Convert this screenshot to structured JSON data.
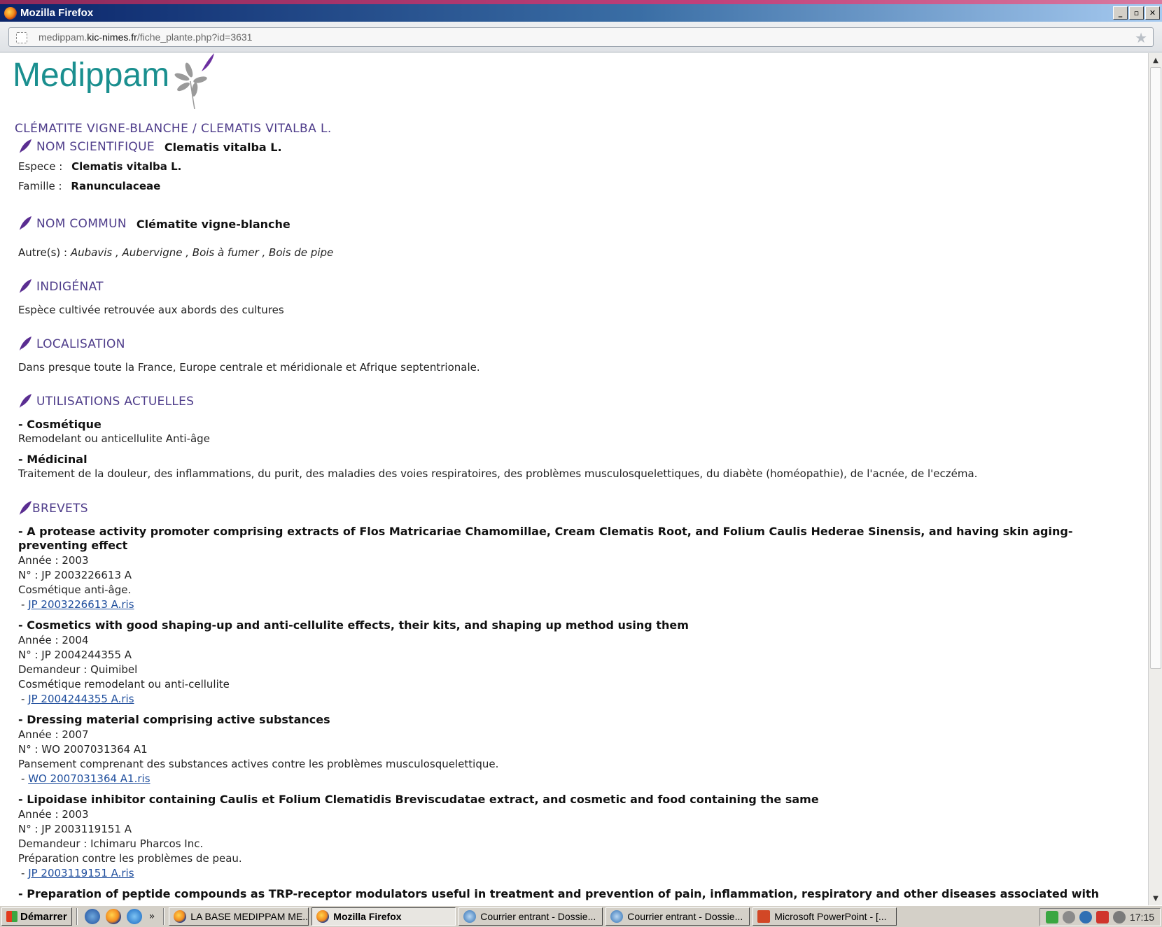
{
  "window": {
    "title": "Mozilla Firefox",
    "buttons": [
      "_",
      "▫",
      "✕"
    ]
  },
  "address": {
    "url_prefix": "medippam.",
    "url_domain": "kic-nimes.fr",
    "url_path": "/fiche_plante.php?id=3631"
  },
  "logo": {
    "text": "Medippam"
  },
  "page": {
    "title": "CLÉMATITE VIGNE-BLANCHE / CLEMATIS VITALBA L."
  },
  "sections": {
    "nom_scientifique": {
      "label": "NOM SCIENTIFIQUE",
      "value": "Clematis vitalba L.",
      "espece_label": "Espece :",
      "espece_value": "Clematis vitalba L.",
      "famille_label": "Famille  :",
      "famille_value": "Ranunculaceae"
    },
    "nom_commun": {
      "label": "NOM COMMUN",
      "value": "Clématite vigne-blanche",
      "autres_label": "Autre(s) :",
      "autres_value": "Aubavis , Aubervigne , Bois à fumer , Bois de pipe"
    },
    "indigenat": {
      "label": "INDIGÉNAT",
      "text": "Espèce cultivée retrouvée aux abords des cultures"
    },
    "localisation": {
      "label": "LOCALISATION",
      "text": "Dans presque toute la France, Europe centrale et méridionale et Afrique septentrionale."
    },
    "utilisations": {
      "label": "UTILISATIONS ACTUELLES",
      "cosmetique_title": "- Cosmétique",
      "cosmetique_text": "Remodelant ou anticellulite Anti-âge",
      "medicinal_title": "- Médicinal",
      "medicinal_text": "Traitement de la douleur, des inflammations, du purit, des maladies des voies respiratoires, des problèmes musculosquelettiques, du diabète (homéopathie), de l'acnée, de l'eczéma."
    },
    "brevets": {
      "label": "BREVETS",
      "items": [
        {
          "title": "- A protease activity promoter comprising extracts of Flos Matricariae Chamomillae, Cream Clematis Root, and Folium Caulis Hederae Sinensis, and having skin aging-preventing effect",
          "annee": "Année : 2003",
          "numero": "N° : JP 2003226613 A",
          "desc": "Cosmétique anti-âge.",
          "link_prefix": " - ",
          "link": "JP 2003226613 A.ris"
        },
        {
          "title": "- Cosmetics with good shaping-up and anti-cellulite effects, their kits, and shaping up method using them",
          "annee": "Année : 2004",
          "numero": "N° : JP 2004244355 A",
          "demandeur": "Demandeur : Quimibel",
          "desc": "Cosmétique remodelant ou anti-cellulite",
          "link_prefix": " - ",
          "link": "JP 2004244355 A.ris"
        },
        {
          "title": "- Dressing material comprising active substances",
          "annee": "Année : 2007",
          "numero": "N° : WO 2007031364 A1",
          "desc": "Pansement comprenant des substances actives contre les problèmes musculosquelettique.",
          "link_prefix": " - ",
          "link": "WO 2007031364 A1.ris"
        },
        {
          "title": "- Lipoidase inhibitor containing Caulis et Folium Clematidis Breviscudatae extract, and cosmetic and food containing the same",
          "annee": "Année : 2003",
          "numero": "N° : JP 2003119151 A",
          "demandeur": "Demandeur : Ichimaru Pharcos Inc.",
          "desc": "Préparation contre les problèmes de peau.",
          "link_prefix": " - ",
          "link": "JP 2003119151 A.ris"
        },
        {
          "title": "- Preparation of peptide compounds as TRP-receptor modulators useful in treatment and prevention of pain, inflammation, respiratory and other diseases associated with"
        }
      ]
    }
  },
  "taskbar": {
    "start_label": "Démarrer",
    "more": "»",
    "tasks": [
      {
        "label": "LA BASE MEDIPPAM   ME..."
      },
      {
        "label": "Mozilla Firefox"
      },
      {
        "label": "Courrier entrant - Dossie..."
      },
      {
        "label": "Courrier entrant - Dossie..."
      },
      {
        "label": "Microsoft PowerPoint - [..."
      }
    ],
    "clock": "17:15"
  },
  "colors": {
    "section_title": "#4e3c8a",
    "logo": "#1a8f8f",
    "feather": "#5a2d91",
    "link": "#1f4e9d"
  }
}
